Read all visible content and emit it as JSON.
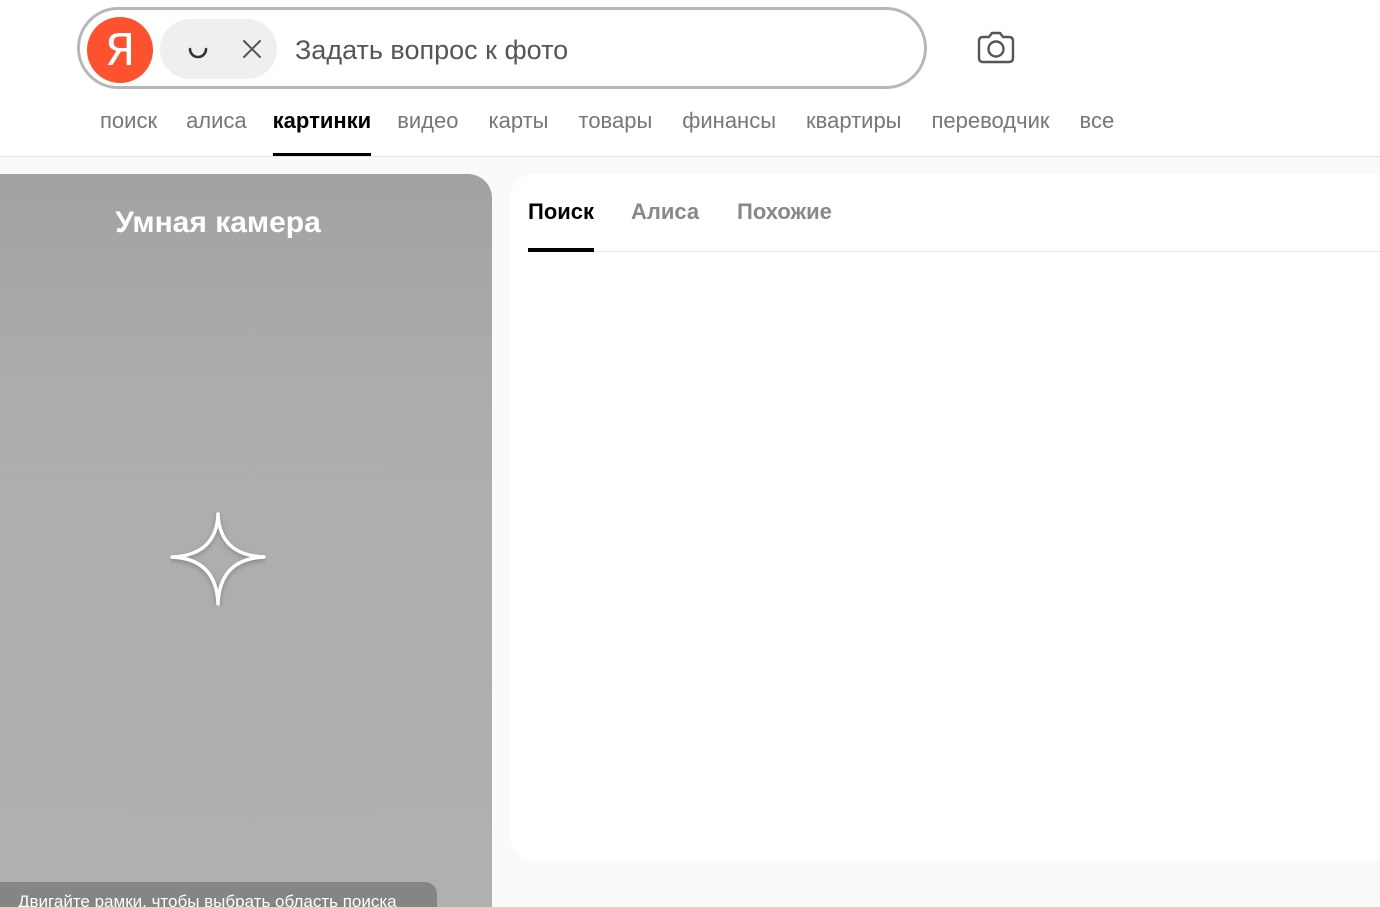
{
  "logo": {
    "letter": "Я",
    "color": "#fc5230"
  },
  "search": {
    "placeholder": "Задать вопрос к фото",
    "value": ""
  },
  "icons": {
    "loading": "loading-icon",
    "close": "close-icon",
    "camera": "camera-icon",
    "sparkle": "sparkle-icon"
  },
  "service_nav": {
    "items": [
      {
        "label": "поиск",
        "active": false
      },
      {
        "label": "алиса",
        "active": false
      },
      {
        "label": "картинки",
        "active": true
      },
      {
        "label": "видео",
        "active": false
      },
      {
        "label": "карты",
        "active": false
      },
      {
        "label": "товары",
        "active": false
      },
      {
        "label": "финансы",
        "active": false
      },
      {
        "label": "квартиры",
        "active": false
      },
      {
        "label": "переводчик",
        "active": false
      },
      {
        "label": "все",
        "active": false
      }
    ]
  },
  "camera_panel": {
    "title": "Умная камера",
    "hint": "Двигайте рамки, чтобы выбрать область поиска"
  },
  "results": {
    "tabs": [
      {
        "label": "Поиск",
        "active": true
      },
      {
        "label": "Алиса",
        "active": false
      },
      {
        "label": "Похожие",
        "active": false
      }
    ]
  }
}
